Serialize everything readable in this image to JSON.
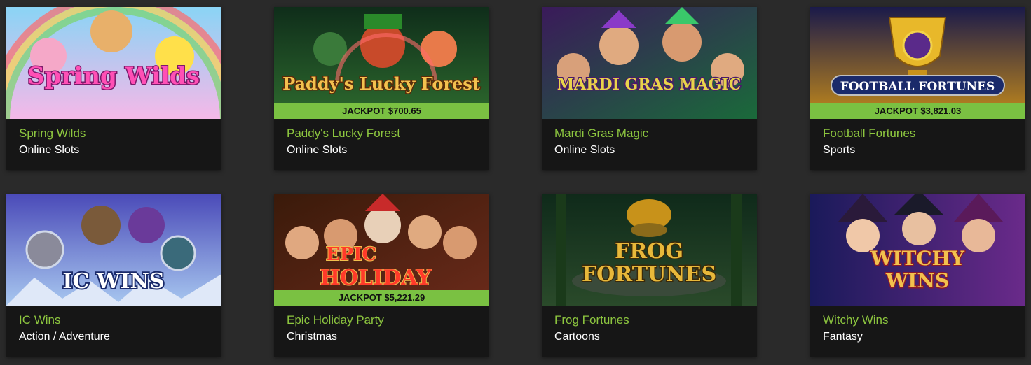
{
  "games": [
    {
      "id": "spring-wilds",
      "title": "Spring Wilds",
      "category": "Online Slots",
      "logo_text": "Spring Wilds",
      "jackpot": null,
      "colors": {
        "bg1": "#8ad4f5",
        "bg2": "#f5b8e8",
        "logo": "#ff4fb5",
        "logo_stroke": "#7a1a6a"
      }
    },
    {
      "id": "paddys-lucky-forest",
      "title": "Paddy's Lucky Forest",
      "category": "Online Slots",
      "logo_text": "Paddy's Lucky Forest",
      "jackpot": "JACKPOT $700.65",
      "colors": {
        "bg1": "#0f2d1a",
        "bg2": "#2e6b2e",
        "logo": "#f2c14e",
        "logo_stroke": "#5a2a0a"
      }
    },
    {
      "id": "mardi-gras-magic",
      "title": "Mardi Gras Magic",
      "category": "Online Slots",
      "logo_text": "MARDI GRAS MAGIC",
      "jackpot": null,
      "colors": {
        "bg1": "#3a1a5a",
        "bg2": "#1a6a3a",
        "logo": "#e8d44a",
        "logo_stroke": "#4a1a6a"
      }
    },
    {
      "id": "football-fortunes",
      "title": "Football Fortunes",
      "category": "Sports",
      "logo_text": "FOOTBALL FORTUNES",
      "jackpot": "JACKPOT $3,821.03",
      "colors": {
        "bg1": "#1a1a4a",
        "bg2": "#c48a1a",
        "logo": "#ffffff",
        "logo_stroke": "#1a2a6a"
      }
    },
    {
      "id": "ic-wins",
      "title": "IC Wins",
      "category": "Action / Adventure",
      "logo_text": "IC WINS",
      "jackpot": null,
      "colors": {
        "bg1": "#4a4ab8",
        "bg2": "#a8c8f0",
        "logo": "#ffffff",
        "logo_stroke": "#1a2a6a"
      }
    },
    {
      "id": "epic-holiday-party",
      "title": "Epic Holiday Party",
      "category": "Christmas",
      "logo_text": "EPIC HOLIDAY",
      "jackpot": "JACKPOT $5,221.29",
      "colors": {
        "bg1": "#3a1a0a",
        "bg2": "#6a2a1a",
        "logo": "#ff3a2a",
        "logo_stroke": "#f2c14e"
      }
    },
    {
      "id": "frog-fortunes",
      "title": "Frog Fortunes",
      "category": "Cartoons",
      "logo_text": "FROG FORTUNES",
      "jackpot": null,
      "colors": {
        "bg1": "#0f2a1a",
        "bg2": "#2a4a2a",
        "logo": "#e8b83a",
        "logo_stroke": "#3a2a0a"
      }
    },
    {
      "id": "witchy-wins",
      "title": "Witchy Wins",
      "category": "Fantasy",
      "logo_text": "WITCHY WINS",
      "jackpot": null,
      "colors": {
        "bg1": "#1a1a5a",
        "bg2": "#6a2a8a",
        "logo": "#f2c14e",
        "logo_stroke": "#8a1a2a"
      }
    }
  ]
}
